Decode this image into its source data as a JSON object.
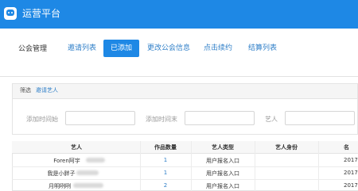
{
  "header": {
    "brand": "运营平台",
    "logo_icon": "robot-icon"
  },
  "section": {
    "title": "公会管理"
  },
  "tabs": [
    {
      "label": "邀请列表",
      "active": false
    },
    {
      "label": "已添加",
      "active": true
    },
    {
      "label": "更改公会信息",
      "active": false
    },
    {
      "label": "点击续约",
      "active": false
    },
    {
      "label": "结算列表",
      "active": false
    }
  ],
  "filter": {
    "label": "筛选",
    "link": "邀请艺人",
    "fields": [
      {
        "label": "添加时间始",
        "value": ""
      },
      {
        "label": "添加时间末",
        "value": ""
      },
      {
        "label": "艺人",
        "value": ""
      }
    ]
  },
  "table": {
    "headers": [
      "艺人",
      "作品数量",
      "艺人类型",
      "艺人身份",
      "名"
    ],
    "rows": [
      {
        "artist": "Foren阿宇",
        "works": "1",
        "type": "用户报名入口",
        "identity": "",
        "date": "2017-"
      },
      {
        "artist": "我是小胖子",
        "works": "1",
        "type": "用户报名入口",
        "identity": "",
        "date": "2017-"
      },
      {
        "artist": "月明咧咧",
        "works": "2",
        "type": "用户报名入口",
        "identity": "",
        "date": "2017-"
      }
    ]
  },
  "colors": {
    "primary": "#1e88e5",
    "link": "#2f7fc8"
  }
}
